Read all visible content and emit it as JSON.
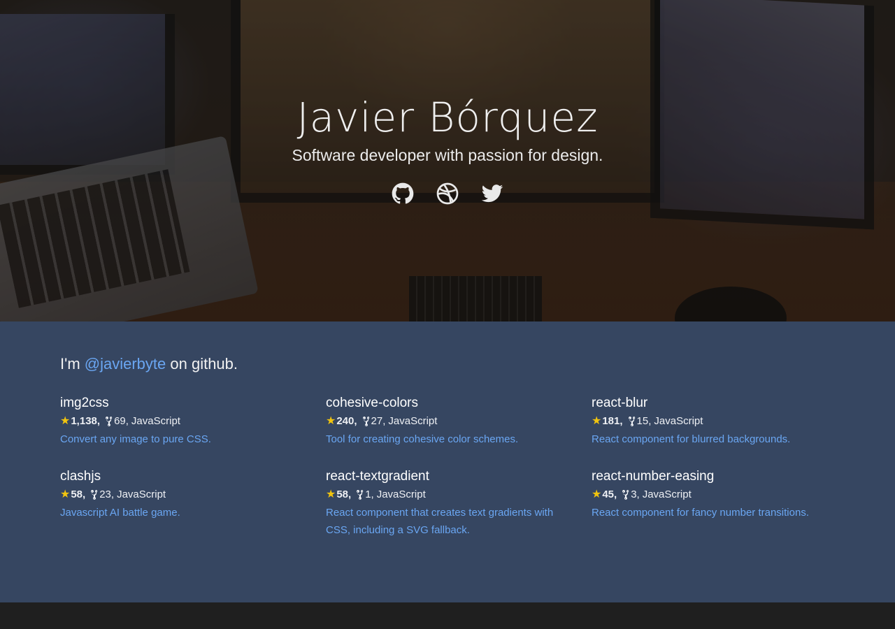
{
  "hero": {
    "title": "Javier Bórquez",
    "tagline": "Software developer with passion for design.",
    "social": [
      {
        "icon": "github-icon"
      },
      {
        "icon": "dribbble-icon"
      },
      {
        "icon": "twitter-icon"
      }
    ]
  },
  "github": {
    "intro_prefix": "I'm ",
    "handle": "@javierbyte",
    "intro_suffix": " on github."
  },
  "repos": [
    {
      "name": "img2css",
      "stars": "1,138,",
      "forks": "69,",
      "language": "JavaScript",
      "description": "Convert any image to pure CSS."
    },
    {
      "name": "cohesive-colors",
      "stars": "240,",
      "forks": "27,",
      "language": "JavaScript",
      "description": "Tool for creating cohesive color schemes."
    },
    {
      "name": "react-blur",
      "stars": "181,",
      "forks": "15,",
      "language": "JavaScript",
      "description": "React component for blurred backgrounds."
    },
    {
      "name": "clashjs",
      "stars": "58,",
      "forks": "23,",
      "language": "JavaScript",
      "description": "Javascript AI battle game."
    },
    {
      "name": "react-textgradient",
      "stars": "58,",
      "forks": "1,",
      "language": "JavaScript",
      "description": "React component that creates text gradients with CSS, including a SVG fallback."
    },
    {
      "name": "react-number-easing",
      "stars": "45,",
      "forks": "3,",
      "language": "JavaScript",
      "description": "React component for fancy number transitions."
    }
  ],
  "colors": {
    "repos_background": "#364661",
    "link": "#6aa6f2",
    "star": "#f1c40f",
    "footer": "#1f1f1f"
  }
}
